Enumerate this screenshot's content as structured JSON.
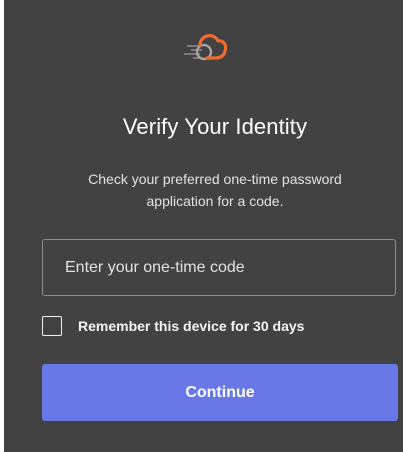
{
  "header": {
    "logo_icon": "cloud-speed-logo-icon",
    "title": "Verify Your Identity",
    "subtitle": "Check your preferred one-time password application for a code."
  },
  "form": {
    "otp_placeholder": "Enter your one-time code",
    "otp_value": "",
    "remember_label": "Remember this device for 30 days",
    "remember_checked": false,
    "continue_label": "Continue"
  },
  "colors": {
    "panel_background": "#424242",
    "accent": "#6878e6",
    "logo_orange": "#f26b2a"
  }
}
